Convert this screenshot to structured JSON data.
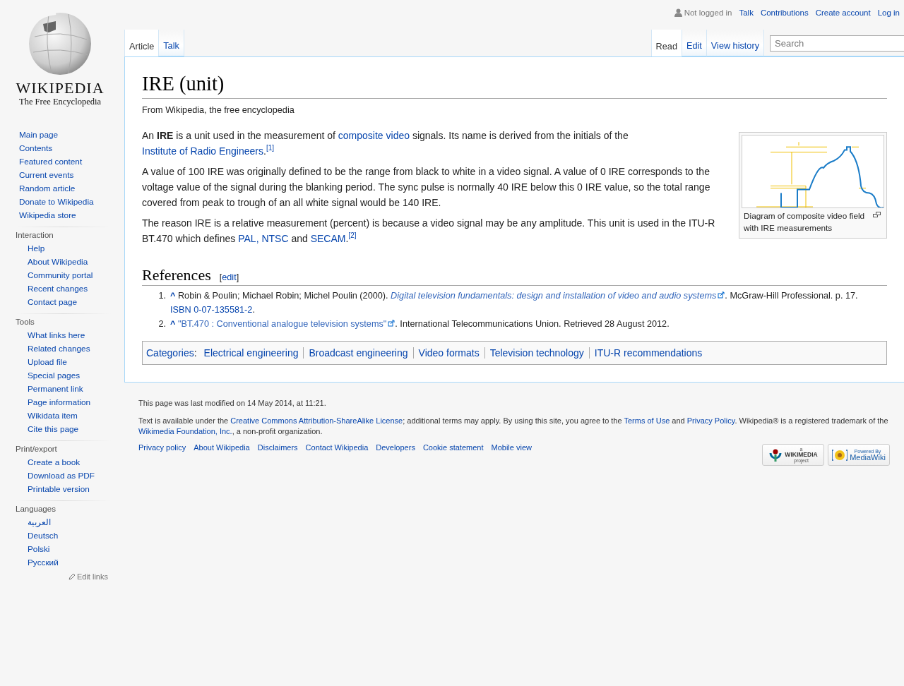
{
  "personal": {
    "status": "Not logged in",
    "links": [
      "Talk",
      "Contributions",
      "Create account",
      "Log in"
    ]
  },
  "logo": {
    "wordmark": "WIKIPEDIA",
    "tagline": "The Free Encyclopedia"
  },
  "sidebar": {
    "main": [
      "Main page",
      "Contents",
      "Featured content",
      "Current events",
      "Random article",
      "Donate to Wikipedia",
      "Wikipedia store"
    ],
    "portals": [
      {
        "heading": "Interaction",
        "items": [
          "Help",
          "About Wikipedia",
          "Community portal",
          "Recent changes",
          "Contact page"
        ]
      },
      {
        "heading": "Tools",
        "items": [
          "What links here",
          "Related changes",
          "Upload file",
          "Special pages",
          "Permanent link",
          "Page information",
          "Wikidata item",
          "Cite this page"
        ]
      },
      {
        "heading": "Print/export",
        "items": [
          "Create a book",
          "Download as PDF",
          "Printable version"
        ]
      },
      {
        "heading": "Languages",
        "items": [
          "العربية",
          "Deutsch",
          "Polski",
          "Русский"
        ]
      }
    ],
    "edit_links": "Edit links"
  },
  "tabs": {
    "left": [
      {
        "label": "Article",
        "selected": true
      },
      {
        "label": "Talk",
        "selected": false
      }
    ],
    "right": [
      {
        "label": "Read",
        "selected": true
      },
      {
        "label": "Edit",
        "selected": false
      },
      {
        "label": "View history",
        "selected": false
      }
    ],
    "search": {
      "placeholder": "Search"
    }
  },
  "article": {
    "title": "IRE (unit)",
    "tagline": "From Wikipedia, the free encyclopedia",
    "paragraphs": [
      [
        {
          "kind": "text",
          "text": "An "
        },
        {
          "kind": "bold",
          "text": "IRE"
        },
        {
          "kind": "text",
          "text": " is a unit used in the measurement of "
        },
        {
          "kind": "link",
          "text": "composite video"
        },
        {
          "kind": "text",
          "text": " signals. Its name is derived from the initials of the "
        },
        {
          "kind": "link",
          "text": "Institute of Radio Engineers"
        },
        {
          "kind": "text",
          "text": "."
        },
        {
          "kind": "ref",
          "text": "[1]"
        }
      ],
      [
        {
          "kind": "text",
          "text": "A value of 100 IRE was originally defined to be the range from black to white in a video signal. A value of 0 IRE corresponds to the voltage value of the signal during the blanking period. The sync pulse is normally 40 IRE below this 0 IRE value, so the total range covered from peak to trough of an all white signal would be 140 IRE."
        }
      ],
      [
        {
          "kind": "text",
          "text": "The reason IRE is a relative measurement (percent) is because a video signal may be any amplitude. This unit is used in the ITU-R BT.470 which defines "
        },
        {
          "kind": "link",
          "text": "PAL"
        },
        {
          "kind": "link",
          "text": ", "
        },
        {
          "kind": "link",
          "text": "NTSC"
        },
        {
          "kind": "text",
          "text": " and "
        },
        {
          "kind": "link",
          "text": "SECAM"
        },
        {
          "kind": "text",
          "text": "."
        },
        {
          "kind": "ref",
          "text": "[2]"
        }
      ]
    ],
    "figure": {
      "kind": "picture",
      "caption": "Diagram of composite video field with IRE measurements"
    },
    "references": {
      "heading": "References",
      "edit": {
        "open": "[",
        "label": "edit",
        "close": "]"
      },
      "items": [
        {
          "number": "1.",
          "backlink": "^",
          "segments": [
            {
              "kind": "text",
              "text": "Robin & Poulin; Michael Robin; Michel Poulin (2000). "
            },
            {
              "kind": "citetitle",
              "text": "Digital television fundamentals: design and installation of video and audio systems"
            },
            {
              "kind": "text",
              "text": ". McGraw-Hill Professional. p. 17. "
            },
            {
              "kind": "link",
              "text": "ISBN 0-07-135581-2"
            },
            {
              "kind": "text",
              "text": "."
            }
          ]
        },
        {
          "number": "2.",
          "backlink": "^",
          "segments": [
            {
              "kind": "extlink",
              "text": "\"BT.470 : Conventional analogue television systems\""
            },
            {
              "kind": "text",
              "text": ". International Telecommunications Union. Retrieved 28 August 2012."
            }
          ]
        }
      ]
    },
    "categories": {
      "label": "Categories",
      "separator": ":",
      "items": [
        "Electrical engineering",
        "Broadcast engineering",
        "Video formats",
        "Television technology",
        "ITU-R recommendations"
      ]
    }
  },
  "footer": {
    "last_modified": "This page was last modified on 14 May 2014, at 11:21.",
    "license": [
      {
        "kind": "text",
        "text": "Text is available under the "
      },
      {
        "kind": "link",
        "text": "Creative Commons Attribution-ShareAlike License"
      },
      {
        "kind": "text",
        "text": "; additional terms may apply. By using this site, you agree to the "
      },
      {
        "kind": "link",
        "text": "Terms of Use"
      },
      {
        "kind": "text",
        "text": " and "
      },
      {
        "kind": "link",
        "text": "Privacy Policy"
      },
      {
        "kind": "text",
        "text": ". Wikipedia® is a registered trademark of the "
      },
      {
        "kind": "link",
        "text": "Wikimedia Foundation, Inc."
      },
      {
        "kind": "text",
        "text": ", a non-profit organization."
      }
    ],
    "links": [
      "Privacy policy",
      "About Wikipedia",
      "Disclaimers",
      "Contact Wikipedia",
      "Developers",
      "Cookie statement",
      "Mobile view"
    ],
    "badges": [
      {
        "kind": "wikimedia",
        "top": "a",
        "main": "WIKIMEDIA",
        "bottom": "project"
      },
      {
        "kind": "mediawiki",
        "top": "Powered By",
        "main": "MediaWiki"
      }
    ]
  }
}
